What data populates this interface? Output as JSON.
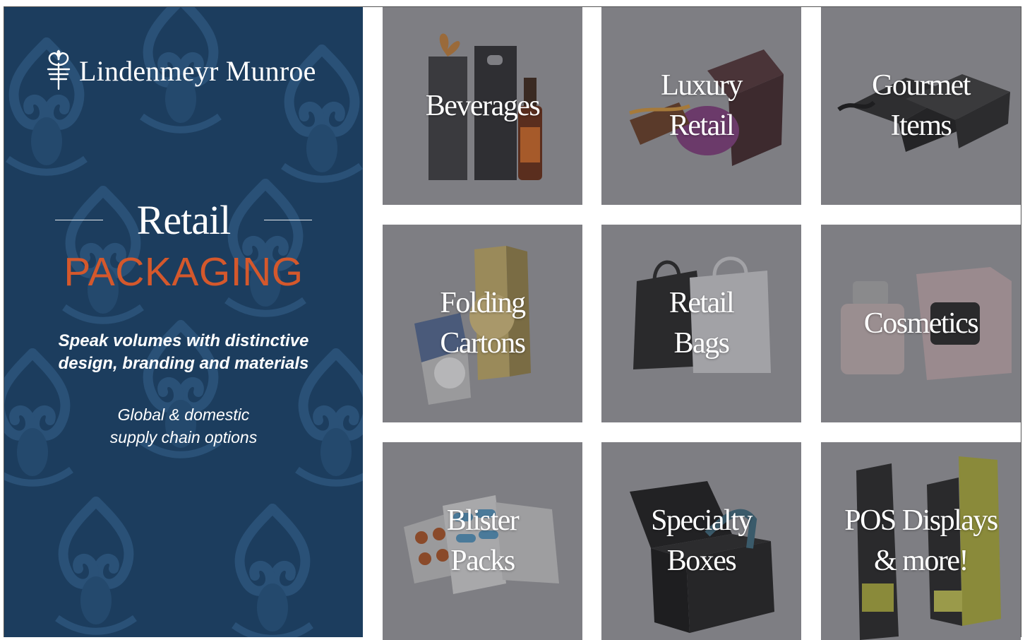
{
  "brand": {
    "name": "Lindenmeyr Munroe",
    "logo_icon": "fleur-icon"
  },
  "hero": {
    "title_serif": "Retail",
    "title_accent": "PACKAGING",
    "tagline_line1": "Speak volumes with distinctive",
    "tagline_line2": "design, branding and materials",
    "supply_line1": "Global & domestic",
    "supply_line2": "supply chain options"
  },
  "colors": {
    "panel": "#1c3d5e",
    "accent": "#d4582c",
    "tile_overlay": "#7e7e83"
  },
  "tiles": [
    {
      "line1": "Beverages",
      "line2": "",
      "icon": "wine-bag-icon"
    },
    {
      "line1": "Luxury",
      "line2": "Retail",
      "icon": "gift-box-icon"
    },
    {
      "line1": "Gourmet",
      "line2": "Items",
      "icon": "gourmet-box-icon"
    },
    {
      "line1": "Folding",
      "line2": "Cartons",
      "icon": "carton-icon"
    },
    {
      "line1": "Retail",
      "line2": "Bags",
      "icon": "shopping-bag-icon"
    },
    {
      "line1": "Cosmetics",
      "line2": "",
      "icon": "perfume-icon"
    },
    {
      "line1": "Blister",
      "line2": "Packs",
      "icon": "blister-pack-icon"
    },
    {
      "line1": "Specialty",
      "line2": "Boxes",
      "icon": "shoe-box-icon"
    },
    {
      "line1": "POS Displays",
      "line2": "& more!",
      "icon": "display-stand-icon"
    }
  ]
}
